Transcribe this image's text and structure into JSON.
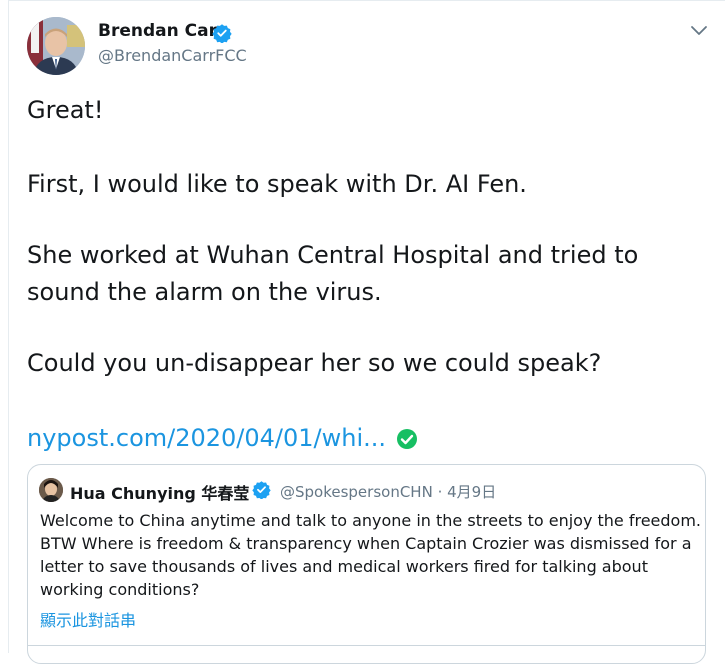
{
  "author": {
    "name": "Brendan Carr",
    "handle": "@BrendanCarrFCC"
  },
  "tweet": {
    "line1": "Great!",
    "line2": "First, I would like to speak with Dr. AI Fen.",
    "line3": "She worked at Wuhan Central Hospital and tried to",
    "line4": "sound the alarm on the virus.",
    "line5": "Could you un-disappear her so we could speak?",
    "link": "nypost.com/2020/04/01/whi..."
  },
  "quote": {
    "name": "Hua Chunying 华春莹",
    "meta": "@SpokespersonCHN · 4月9日",
    "line1": "Welcome to China anytime and talk to anyone in the streets to enjoy the freedom.",
    "line2": "BTW Where is freedom & transparency when Captain Crozier was dismissed for a",
    "line3": "letter to save thousands of lives and medical workers fired for talking about",
    "line4": "working conditions?",
    "thread_link": "顯示此對話串"
  },
  "colors": {
    "verified": "#1da1f2",
    "link": "#1b95e0",
    "secondary": "#657786",
    "check": "#17bf63"
  },
  "icons": [
    "verified-icon",
    "chevron-down-icon",
    "check-circle-icon"
  ]
}
